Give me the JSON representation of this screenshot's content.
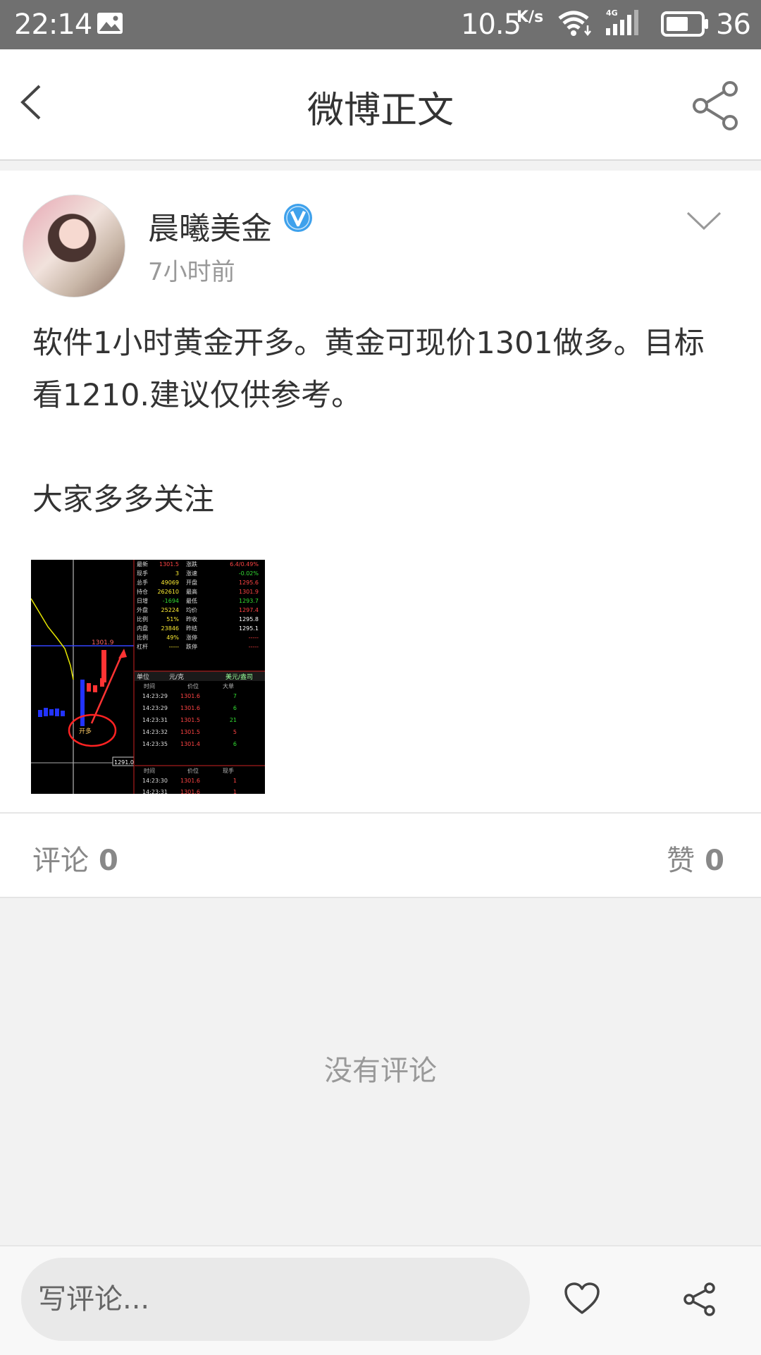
{
  "status_bar": {
    "time": "22:14",
    "net_speed": "10.5",
    "net_speed_unit": "K/s",
    "battery_level": "36",
    "icons": [
      "image-icon",
      "wifi-icon",
      "signal-4g-icon",
      "battery-icon"
    ]
  },
  "header": {
    "title": "微博正文"
  },
  "post": {
    "author": "晨曦美金",
    "verified": true,
    "time_ago": "7小时前",
    "content": "软件1小时黄金开多。黄金可现价1301做多。目标看1210.建议仅供参考。\n\n大家多多关注",
    "image": {
      "quote_rows": [
        [
          "最新",
          "1301.5",
          "涨跌",
          "6.4/0.49%"
        ],
        [
          "现手",
          "3",
          "涨速",
          "-0.02%"
        ],
        [
          "总手",
          "49069",
          "开盘",
          "1295.6"
        ],
        [
          "持仓",
          "262610",
          "最高",
          "1301.9"
        ],
        [
          "日增",
          "-1694",
          "最低",
          "1293.7"
        ],
        [
          "外盘",
          "25224",
          "均价",
          "1297.4"
        ],
        [
          "比例",
          "51%",
          "昨收",
          "1295.8"
        ],
        [
          "内盘",
          "23846",
          "昨结",
          "1295.1"
        ],
        [
          "比例",
          "49%",
          "涨停",
          "-----"
        ],
        [
          "杠杆",
          "-----",
          "跌停",
          "-----"
        ]
      ],
      "unit_label": "单位",
      "unit_value": "元/克",
      "unit_alt": "美元/盎司",
      "trade_headers": [
        "时间",
        "价位",
        "大单"
      ],
      "trades": [
        [
          "14:23:29",
          "1301.6",
          "7"
        ],
        [
          "14:23:29",
          "1301.6",
          "6"
        ],
        [
          "14:23:31",
          "1301.5",
          "21"
        ],
        [
          "14:23:32",
          "1301.5",
          "5"
        ],
        [
          "14:23:35",
          "1301.4",
          "6"
        ]
      ],
      "trade_headers2": [
        "时间",
        "价位",
        "现手"
      ],
      "trades2": [
        [
          "14:23:30",
          "1301.6",
          "1"
        ],
        [
          "14:23:31",
          "1301.6",
          "1"
        ]
      ],
      "chart_high": "1301.9",
      "chart_low": "1291.0",
      "chart_mark": "开多"
    }
  },
  "stats": {
    "comments_label": "评论",
    "comments_count": "0",
    "likes_label": "赞",
    "likes_count": "0"
  },
  "empty_text": "没有评论",
  "bottom_bar": {
    "placeholder": "写评论..."
  },
  "colors": {
    "status_bar_bg": "#707070",
    "verified_badge": "#3ea1ec",
    "page_bg": "#f2f2f2"
  }
}
